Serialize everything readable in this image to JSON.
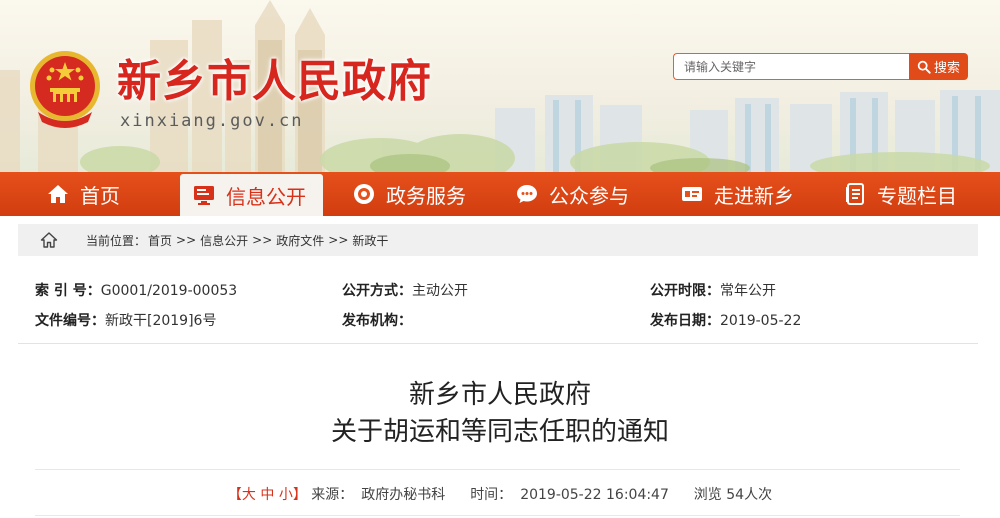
{
  "site": {
    "title": "新乡市人民政府",
    "domain": "xinxiang.gov.cn"
  },
  "search": {
    "placeholder": "请输入关键字",
    "button_label": "搜索"
  },
  "nav": {
    "items": [
      {
        "label": "首页",
        "icon": "home-icon"
      },
      {
        "label": "信息公开",
        "icon": "monitor-icon",
        "active": true
      },
      {
        "label": "政务服务",
        "icon": "service-icon"
      },
      {
        "label": "公众参与",
        "icon": "chat-icon"
      },
      {
        "label": "走进新乡",
        "icon": "id-card-icon"
      },
      {
        "label": "专题栏目",
        "icon": "document-icon"
      }
    ]
  },
  "breadcrumb": {
    "label": "当前位置：",
    "separator": ">>",
    "items": [
      "首页",
      "信息公开",
      "政府文件",
      "新政干"
    ]
  },
  "meta": {
    "index_label": "索 引 号：",
    "index_value": "G0001/2019-00053",
    "method_label": "公开方式：",
    "method_value": "主动公开",
    "period_label": "公开时限：",
    "period_value": "常年公开",
    "docno_label": "文件编号：",
    "docno_value": "新政干[2019]6号",
    "issuer_label": "发布机构：",
    "issuer_value": "",
    "date_label": "发布日期：",
    "date_value": "2019-05-22"
  },
  "document": {
    "title_line1": "新乡市人民政府",
    "title_line2": "关于胡运和等同志任职的通知"
  },
  "info": {
    "bracket_open": "【",
    "size_large": "大",
    "size_medium": "中",
    "size_small": "小",
    "bracket_close": "】",
    "source_label": "来源：",
    "source_value": "政府办秘书科",
    "time_label": "时间：",
    "time_value": "2019-05-22 16:04:47",
    "views_label": "浏览",
    "views_value": "54",
    "views_unit": "人次"
  },
  "colors": {
    "brand_red": "#d7261e",
    "nav_orange": "#e5501b",
    "search_button": "#e14b1a"
  }
}
